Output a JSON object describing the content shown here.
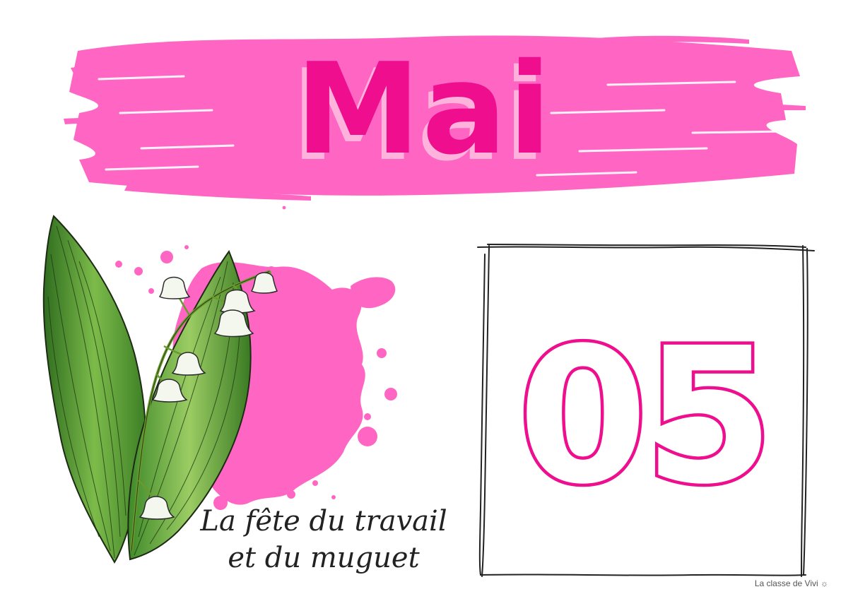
{
  "month": "Mai",
  "day": "05",
  "event": {
    "line1": "La fête du travail",
    "line2": "et du muguet"
  },
  "credit": "La classe de Vivi ☼",
  "illustration": "lily-of-the-valley",
  "colors": {
    "accent": "#ff66c4",
    "accent_dark": "#ee0e8e",
    "accent_light": "#ffb3dc",
    "leaf": "#4e9a34",
    "ink": "#222222"
  }
}
